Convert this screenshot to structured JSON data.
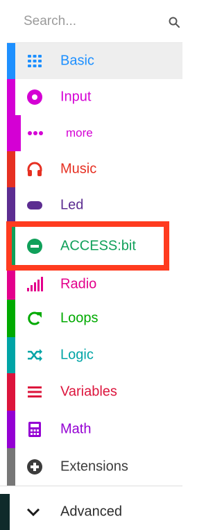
{
  "search": {
    "placeholder": "Search..."
  },
  "categories": [
    {
      "label": "Basic",
      "color": "#1e90ff",
      "icon": "grid-icon"
    },
    {
      "label": "Input",
      "color": "#d400d4",
      "icon": "radio-target-icon"
    },
    {
      "label": "more",
      "color": "#d400d4",
      "icon": "more-dots-icon"
    },
    {
      "label": "Music",
      "color": "#e63022",
      "icon": "headphones-icon"
    },
    {
      "label": "Led",
      "color": "#5c2d91",
      "icon": "led-toggle-icon"
    },
    {
      "label": "ACCESS:bit",
      "color": "#10a05a",
      "icon": "minus-circle-icon"
    },
    {
      "label": "Radio",
      "color": "#e3008c",
      "icon": "signal-bars-icon"
    },
    {
      "label": "Loops",
      "color": "#00aa00",
      "icon": "loop-arrow-icon"
    },
    {
      "label": "Logic",
      "color": "#00a4a6",
      "icon": "shuffle-icon"
    },
    {
      "label": "Variables",
      "color": "#dc143c",
      "icon": "list-lines-icon"
    },
    {
      "label": "Math",
      "color": "#9400d3",
      "icon": "calculator-icon"
    },
    {
      "label": "Extensions",
      "color": "#777777",
      "icon": "plus-circle-icon"
    }
  ],
  "advanced": {
    "label": "Advanced",
    "bar_color": "#0f2b2b",
    "icon": "chevron-down-icon"
  },
  "highlight": {
    "color": "#ff3b1f",
    "target": "ACCESS:bit"
  }
}
